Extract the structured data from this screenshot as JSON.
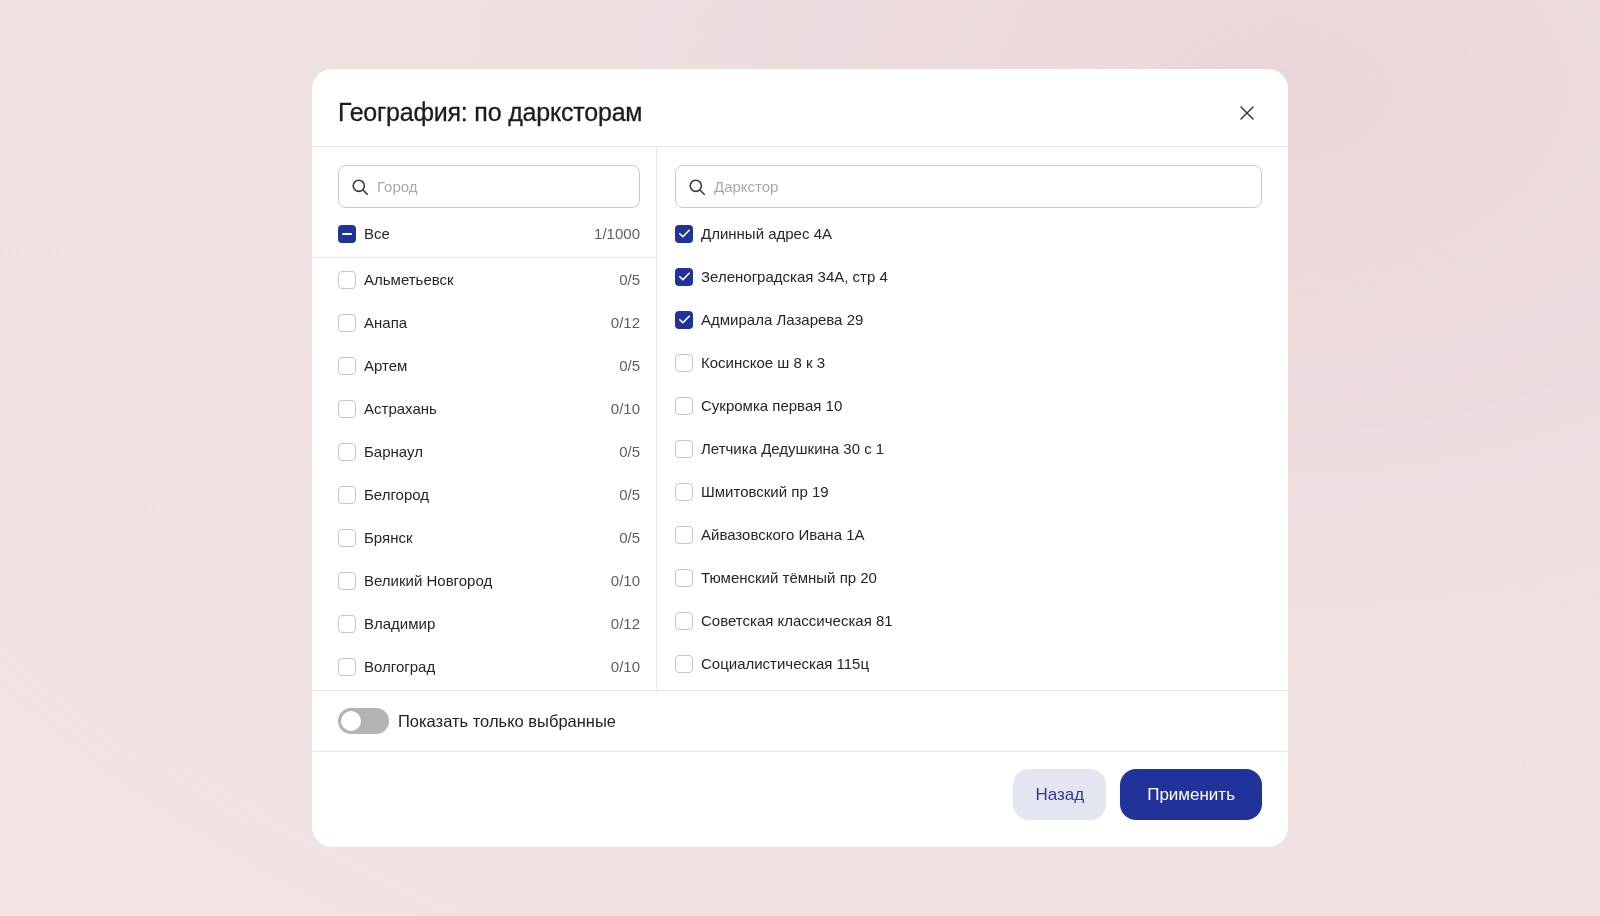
{
  "dialog": {
    "title": "География: по дарксторам"
  },
  "cities": {
    "search": {
      "placeholder": "Город"
    },
    "all": {
      "label": "Все",
      "count": "1/1000",
      "indeterminate": true
    },
    "items": [
      {
        "label": "Альметьевск",
        "count": "0/5",
        "checked": false
      },
      {
        "label": "Анапа",
        "count": "0/12",
        "checked": false
      },
      {
        "label": "Артем",
        "count": "0/5",
        "checked": false
      },
      {
        "label": "Астрахань",
        "count": "0/10",
        "checked": false
      },
      {
        "label": "Барнаул",
        "count": "0/5",
        "checked": false
      },
      {
        "label": "Белгород",
        "count": "0/5",
        "checked": false
      },
      {
        "label": "Брянск",
        "count": "0/5",
        "checked": false
      },
      {
        "label": "Великий Новгород",
        "count": "0/10",
        "checked": false
      },
      {
        "label": "Владимир",
        "count": "0/12",
        "checked": false
      },
      {
        "label": "Волгоград",
        "count": "0/10",
        "checked": false
      }
    ]
  },
  "darkstores": {
    "search": {
      "placeholder": "Даркстор"
    },
    "items": [
      {
        "label": "Длинный адрес 4А",
        "checked": true
      },
      {
        "label": "Зеленоградская 34А, стр 4",
        "checked": true
      },
      {
        "label": "Адмирала Лазарева 29",
        "checked": true
      },
      {
        "label": "Косинское ш 8 к 3",
        "checked": false
      },
      {
        "label": "Сукромка первая 10",
        "checked": false
      },
      {
        "label": "Летчика Дедушкина 30 с 1",
        "checked": false
      },
      {
        "label": "Шмитовский пр 19",
        "checked": false
      },
      {
        "label": "Айвазовского Ивана 1А",
        "checked": false
      },
      {
        "label": "Тюменский тёмный пр 20",
        "checked": false
      },
      {
        "label": "Советская классическая 81",
        "checked": false
      },
      {
        "label": "Социалистическая 115ц",
        "checked": false
      }
    ]
  },
  "show_selected_only": {
    "label": "Показать только выбранные",
    "on": false
  },
  "buttons": [
    {
      "label": "Назад",
      "kind": "secondary"
    },
    {
      "label": "Применить",
      "kind": "primary"
    }
  ]
}
